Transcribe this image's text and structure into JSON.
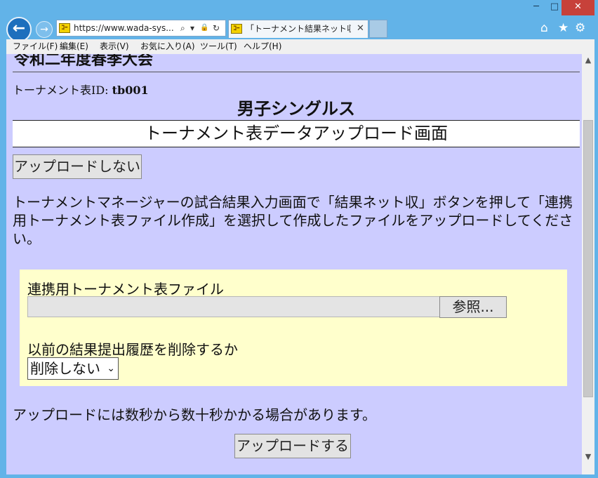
{
  "window": {
    "minimize_label": "─",
    "maximize_label": "□",
    "close_label": "✕"
  },
  "nav": {
    "back_icon": "←",
    "forward_icon": "→",
    "address": "https://www.wada-sys...",
    "site_icon_text": "ｺｰ",
    "search_icon": "⌕",
    "dropdown_icon": "▾",
    "lock_icon": "🔒",
    "refresh_icon": "↻"
  },
  "tab": {
    "title": "「トーナメント結果ネット収集」...",
    "close_label": "✕"
  },
  "toolbar_icons": {
    "home": "⌂",
    "favorites": "★",
    "settings": "⚙"
  },
  "menubar": {
    "items": [
      "ファイル(F)",
      "編集(E)",
      "表示(V)",
      "お気に入り(A)",
      "ツール(T)",
      "ヘルプ(H)"
    ]
  },
  "page": {
    "title": "令和二年度春季大会",
    "tournament_id_label": "トーナメント表ID: ",
    "tournament_id_value": "tb001",
    "event_name": "男子シングルス",
    "subtitle": "トーナメント表データアップロード画面",
    "no_upload_button": "アップロードしない",
    "instructions": "トーナメントマネージャーの試合結果入力画面で「結果ネット収」ボタンを押して「連携用トーナメント表ファイル作成」を選択して作成したファイルをアップロードしてください。",
    "file_label": "連携用トーナメント表ファイル",
    "browse_button": "参照...",
    "delete_history_label": "以前の結果提出履歴を削除するか",
    "delete_history_selected": "削除しない",
    "note": "アップロードには数秒から数十秒かかる場合があります。",
    "upload_button": "アップロードする"
  },
  "scrollbar": {
    "up_icon": "▲",
    "down_icon": "▼"
  },
  "colors": {
    "page_background": "#ccccff",
    "upload_panel": "#ffffcc",
    "window_frame": "#62b3e8",
    "close_button": "#c7413a"
  }
}
